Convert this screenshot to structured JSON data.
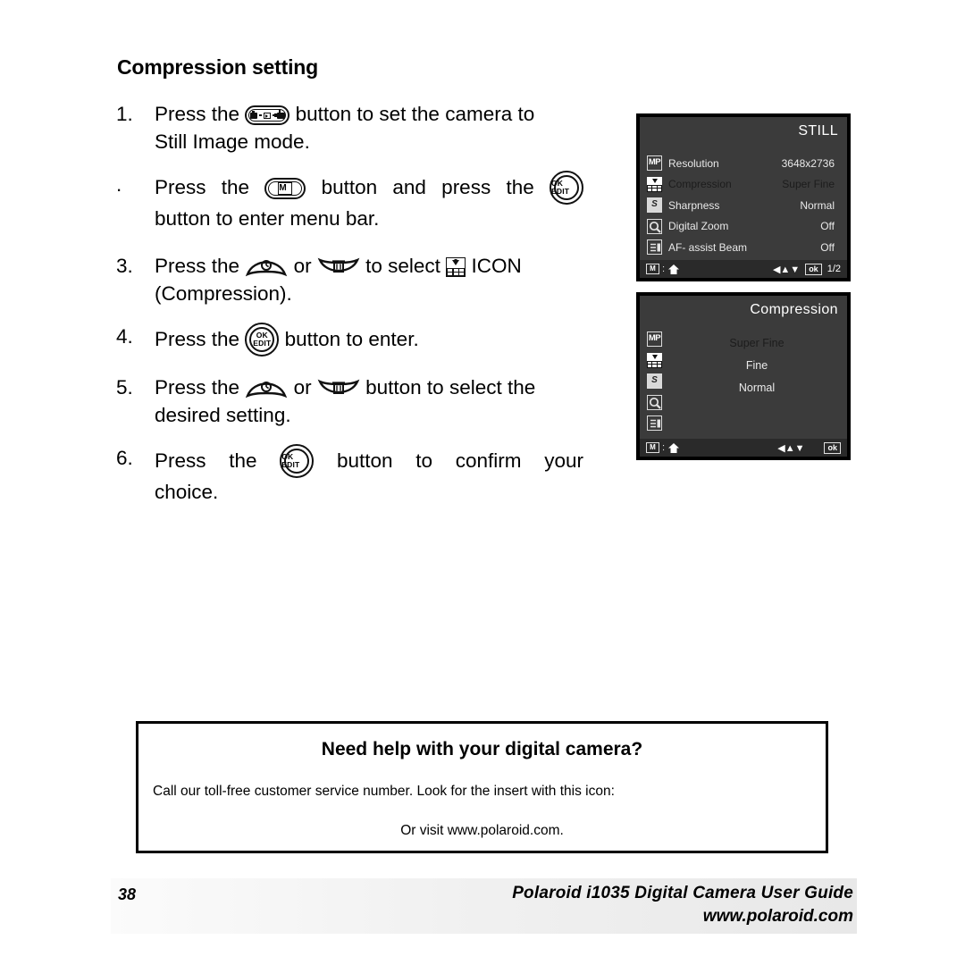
{
  "heading": "Compression setting",
  "steps": [
    {
      "num": "1.",
      "text_a": "Press the",
      "icon": "mode-button",
      "text_b": "button to set the camera to",
      "line2": "Still Image mode."
    },
    {
      "num": ".",
      "text_a": "Press the",
      "icon": "menu-m-button",
      "text_b": "button and press the",
      "icon2": "ok-edit-button",
      "line2": "button to enter menu bar."
    },
    {
      "num": "3.",
      "text_a": "Press the",
      "icon": "self-timer-up-button",
      "text_mid": "or",
      "icon2": "trash-down-button",
      "text_b": "to select",
      "icon3": "compression-icon",
      "text_c": "ICON",
      "line2": "(Compression)."
    },
    {
      "num": "4.",
      "text_a": "Press the",
      "icon": "ok-edit-button",
      "text_b": "button to enter."
    },
    {
      "num": "5.",
      "text_a": "Press the",
      "icon": "self-timer-up-button",
      "text_mid": "or",
      "icon2": "trash-down-button",
      "text_b": "button to select the",
      "line2": "desired setting."
    },
    {
      "num": "6.",
      "text_a": "Press the",
      "icon": "ok-edit-button",
      "text_b": "button to confirm your",
      "line2": "choice."
    }
  ],
  "button_labels": {
    "ok_line1": "OK",
    "ok_line2": "EDIT",
    "m_label": "M"
  },
  "lcd_still": {
    "title": "STILL",
    "rows": [
      {
        "icon": "mp-icon",
        "label": "Resolution",
        "value": "3648x2736",
        "dimmed": false
      },
      {
        "icon": "compression-icon",
        "label": "Compression",
        "value": "Super Fine",
        "dimmed": true
      },
      {
        "icon": "sharpness-icon",
        "label": "Sharpness",
        "value": "Normal",
        "dimmed": false
      },
      {
        "icon": "digital-zoom-icon",
        "label": "Digital Zoom",
        "value": "Off",
        "dimmed": false
      },
      {
        "icon": "af-assist-beam-icon",
        "label": "AF- assist Beam",
        "value": "Off",
        "dimmed": false
      }
    ],
    "status": {
      "m_label": "M",
      "colon": ":",
      "home_icon": "home-icon",
      "arrows": "◀▲▼",
      "ok_label": "ok",
      "page": "1/2"
    }
  },
  "lcd_compression": {
    "title": "Compression",
    "icons": [
      "mp-icon",
      "compression-icon",
      "sharpness-icon",
      "digital-zoom-icon",
      "af-assist-beam-icon"
    ],
    "options": [
      {
        "label": "Super Fine",
        "dimmed": true
      },
      {
        "label": "Fine",
        "dimmed": false
      },
      {
        "label": "Normal",
        "dimmed": false
      }
    ],
    "status": {
      "m_label": "M",
      "colon": ":",
      "home_icon": "home-icon",
      "arrows": "◀▲▼",
      "ok_label": "ok"
    }
  },
  "help_box": {
    "title": "Need help with your digital camera?",
    "line1": "Call our toll-free customer service number. Look for the insert with this icon:",
    "line2": "Or visit www.polaroid.com."
  },
  "footer": {
    "page_number": "38",
    "guide_title": "Polaroid i1035 Digital Camera User Guide",
    "url": "www.polaroid.com"
  },
  "colors": {
    "lcd_background": "#3b3b3b",
    "lcd_status_bar": "#2a2a2a",
    "lcd_text": "#e9e9e9",
    "lcd_dim_text": "#1c1c1c",
    "page_background": "#ffffff",
    "ink": "#000000"
  }
}
